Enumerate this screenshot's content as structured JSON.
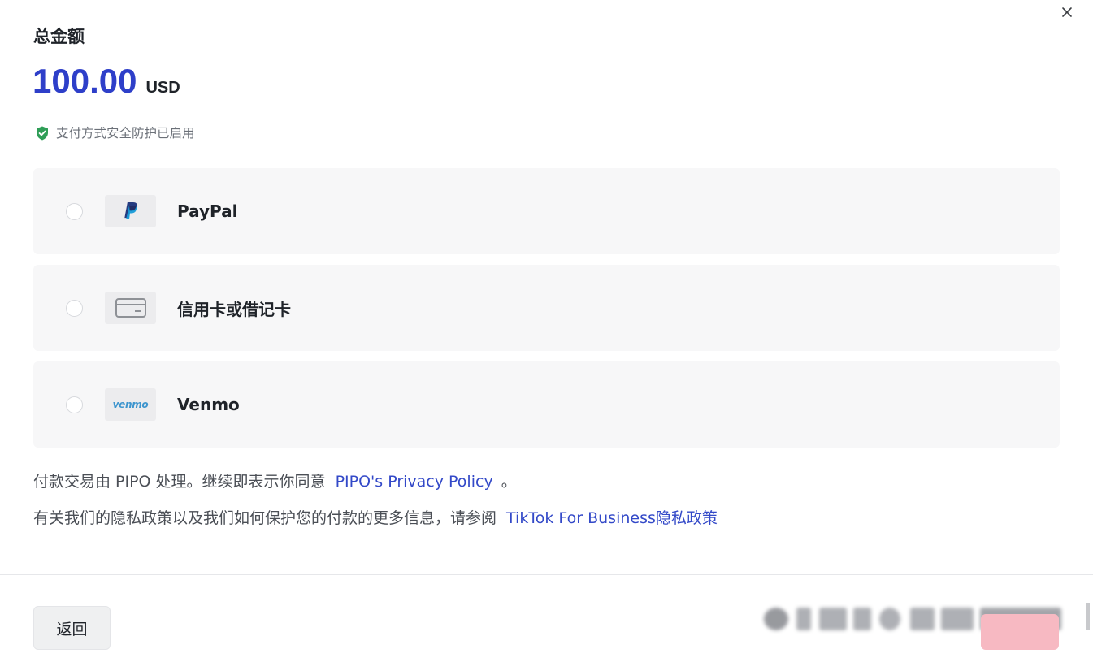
{
  "header": {
    "total_label": "总金额",
    "amount": "100.00",
    "currency": "USD",
    "security_note": "支付方式安全防护已启用"
  },
  "payment_methods": [
    {
      "label": "PayPal",
      "icon": "paypal-logo"
    },
    {
      "label": "信用卡或借记卡",
      "icon": "credit-card-icon"
    },
    {
      "label": "Venmo",
      "icon": "venmo-logo",
      "logo_text": "venmo"
    }
  ],
  "legal": {
    "line1_text": "付款交易由 PIPO 处理。继续即表示你同意",
    "line1_link": "PIPO's Privacy Policy",
    "line1_end": "。",
    "line2_text": "有关我们的隐私政策以及我们如何保护您的付款的更多信息，请参阅",
    "line2_link": "TikTok For Business隐私政策"
  },
  "footer": {
    "back_label": "返回"
  },
  "colors": {
    "amount": "#2e3fc9",
    "link": "#3349c8",
    "shield": "#2f9e57",
    "pay_button": "#f7b9c2",
    "method_bg": "#f7f7f8"
  }
}
